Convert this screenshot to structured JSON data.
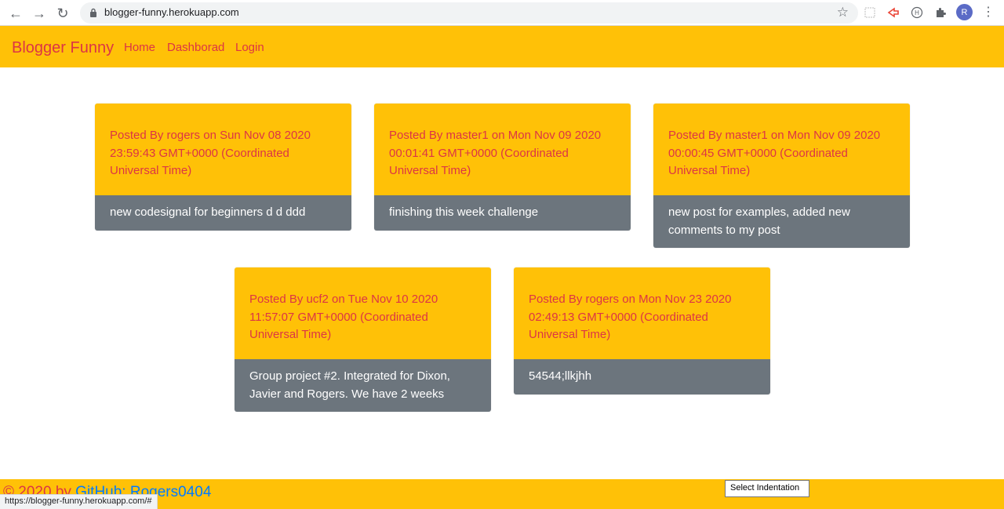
{
  "browser": {
    "url": "blogger-funny.herokuapp.com",
    "back_icon": "←",
    "forward_icon": "→",
    "reload_icon": "↻",
    "avatar_letter": "R",
    "status_url": "https://blogger-funny.herokuapp.com/#"
  },
  "navbar": {
    "brand": "Blogger Funny",
    "links": [
      "Home",
      "Dashborad",
      "Login"
    ],
    "colors": {
      "background": "#ffc107",
      "text": "#dc3545"
    }
  },
  "posts": [
    {
      "header": "Posted By rogers on Sun Nov 08 2020 23:59:43 GMT+0000 (Coordinated Universal Time)",
      "body": "new codesignal for beginners d d ddd"
    },
    {
      "header": "Posted By master1 on Mon Nov 09 2020 00:01:41 GMT+0000 (Coordinated Universal Time)",
      "body": "finishing this week challenge"
    },
    {
      "header": "Posted By master1 on Mon Nov 09 2020 00:00:45 GMT+0000 (Coordinated Universal Time)",
      "body": "new post for examples, added new comments to my post"
    },
    {
      "header": "Posted By ucf2 on Tue Nov 10 2020 11:57:07 GMT+0000 (Coordinated Universal Time)",
      "body": "Group project #2. Integrated for Dixon, Javier and Rogers. We have 2 weeks"
    },
    {
      "header": "Posted By rogers on Mon Nov 23 2020 02:49:13 GMT+0000 (Coordinated Universal Time)",
      "body": "54544;llkjhh"
    }
  ],
  "footer": {
    "prefix": "© 2020 by ",
    "link": "GitHub: Rogers0404"
  },
  "tooltip": "Select Indentation",
  "colors": {
    "card_header": "#ffc107",
    "card_body": "#6c757d",
    "footer_link": "#007bff"
  }
}
